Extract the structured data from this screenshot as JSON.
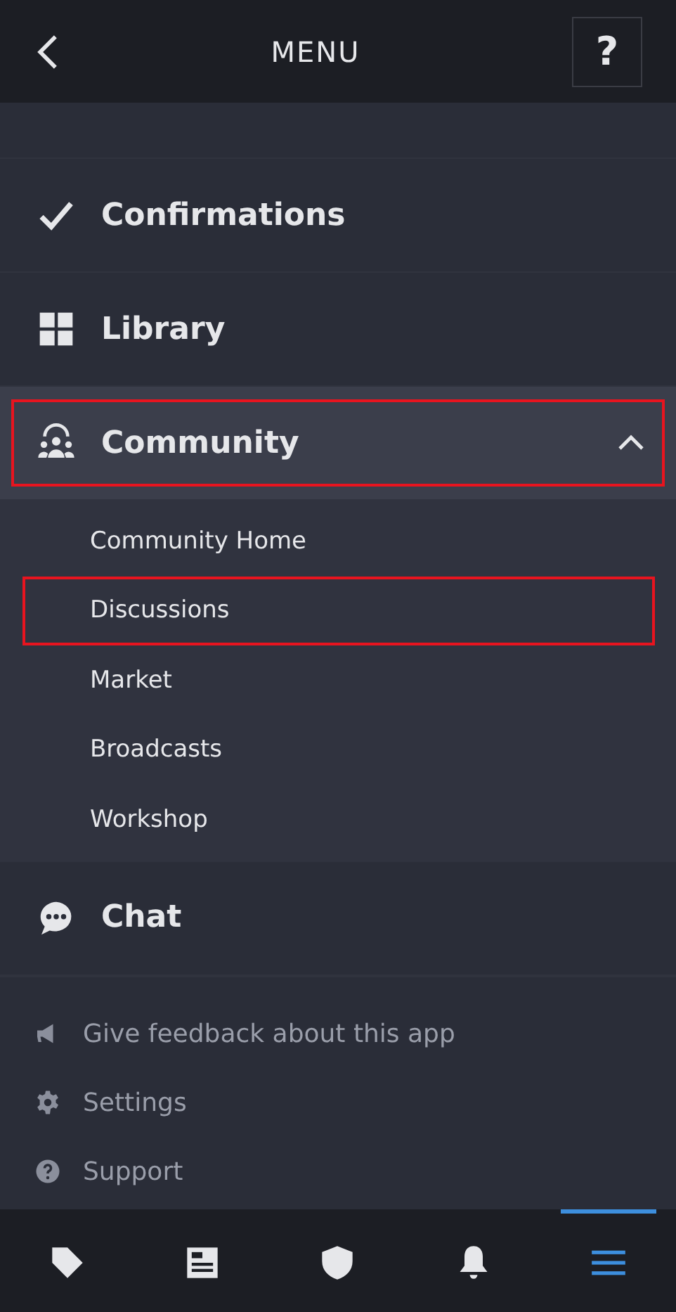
{
  "header": {
    "title": "MENU",
    "help_label": "?"
  },
  "menu": [
    {
      "kind": "check",
      "label": "Confirmations",
      "highlighted": false
    },
    {
      "kind": "grid",
      "label": "Library",
      "highlighted": false
    },
    {
      "kind": "community",
      "label": "Community",
      "highlighted": true,
      "expanded": true,
      "children": [
        {
          "label": "Community Home",
          "highlighted": false
        },
        {
          "label": "Discussions",
          "highlighted": true
        },
        {
          "label": "Market",
          "highlighted": false
        },
        {
          "label": "Broadcasts",
          "highlighted": false
        },
        {
          "label": "Workshop",
          "highlighted": false
        }
      ]
    },
    {
      "kind": "chat",
      "label": "Chat",
      "highlighted": false
    }
  ],
  "footer_links": [
    {
      "kind": "megaphone",
      "label": "Give feedback about this app"
    },
    {
      "kind": "gear",
      "label": "Settings"
    },
    {
      "kind": "help",
      "label": "Support"
    }
  ],
  "bottom_nav": [
    {
      "kind": "tag",
      "selected": false
    },
    {
      "kind": "news",
      "selected": false
    },
    {
      "kind": "shield",
      "selected": false
    },
    {
      "kind": "bell",
      "selected": false
    },
    {
      "kind": "menu",
      "selected": true
    }
  ]
}
